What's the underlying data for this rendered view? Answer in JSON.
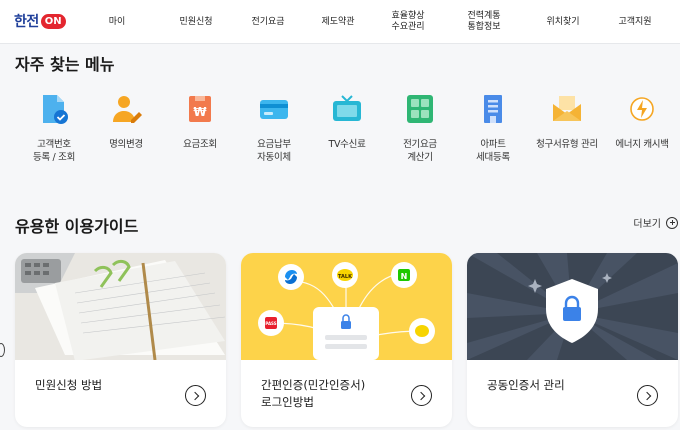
{
  "header": {
    "logo_text": "한전",
    "logo_badge": "ON",
    "nav": [
      {
        "label": "마이"
      },
      {
        "label": "민원신청"
      },
      {
        "label": "전기요금"
      },
      {
        "label": "제도약관"
      },
      {
        "label": "효율향상\n수요관리"
      },
      {
        "label": "전력계통\n통합정보"
      },
      {
        "label": "위치찾기"
      },
      {
        "label": "고객지원"
      }
    ]
  },
  "quick_menu": {
    "title": "자주 찾는 메뉴",
    "items": [
      {
        "label": "고객번호\n등록 / 조회",
        "icon": "document-check-icon"
      },
      {
        "label": "명의변경",
        "icon": "person-edit-icon"
      },
      {
        "label": "요금조회",
        "icon": "won-bill-icon"
      },
      {
        "label": "요금납부\n자동이체",
        "icon": "credit-card-icon"
      },
      {
        "label": "TV수신료",
        "icon": "tv-icon"
      },
      {
        "label": "전기요금\n계산기",
        "icon": "calculator-icon"
      },
      {
        "label": "아파트\n세대등록",
        "icon": "apartment-icon"
      },
      {
        "label": "청구서유형 관리",
        "icon": "envelope-icon"
      },
      {
        "label": "에너지 캐시백",
        "icon": "energy-bolt-icon"
      }
    ]
  },
  "guides": {
    "title": "유용한 이용가이드",
    "more_label": "더보기",
    "cards": [
      {
        "label": "민원신청 방법",
        "image": "paperwork-photo"
      },
      {
        "label": "간편인증(민간인증서)\n로그인방법",
        "image": "simple-auth-illustration"
      },
      {
        "label": "공동인증서 관리",
        "image": "certificate-shield-illustration"
      }
    ]
  },
  "colors": {
    "accent_blue": "#1f3f9a",
    "accent_red": "#e3262f",
    "auth_yellow": "#fdd34a",
    "cert_dark": "#3c4654"
  }
}
